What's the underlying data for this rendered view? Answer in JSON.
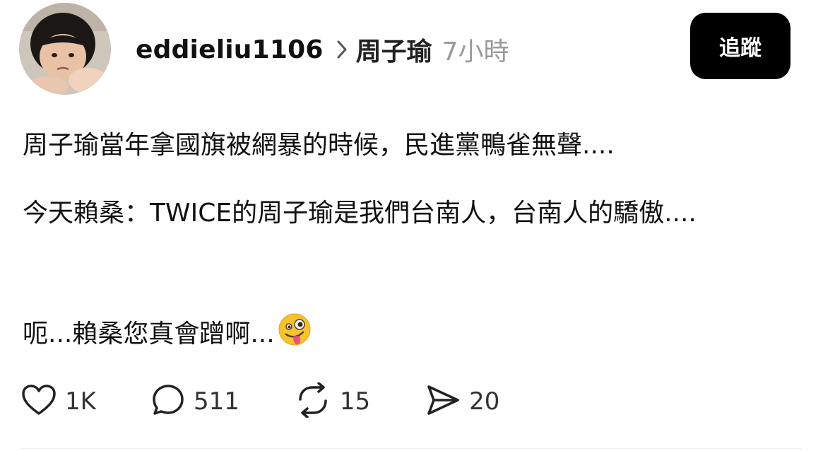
{
  "header": {
    "username": "eddieliu1106",
    "topic": "周子瑜",
    "time": "7小時",
    "follow_label": "追蹤"
  },
  "post": {
    "paragraph_1": "周子瑜當年拿國旗被網暴的時候，民進黨鴨雀無聲....",
    "paragraph_2": "今天賴桑：TWICE的周子瑜是我們台南人，台南人的驕傲....",
    "paragraph_3": "呃...賴桑您真會蹭啊...",
    "emoji": "zany-face"
  },
  "actions": {
    "likes": "1K",
    "comments": "511",
    "reposts": "15",
    "shares": "20"
  },
  "icons": [
    "heart-icon",
    "comment-icon",
    "repost-icon",
    "send-icon",
    "chevron-right-icon"
  ],
  "colors": {
    "text": "#111111",
    "muted": "#9a9a9a",
    "button_bg": "#000000",
    "button_text": "#ffffff"
  }
}
